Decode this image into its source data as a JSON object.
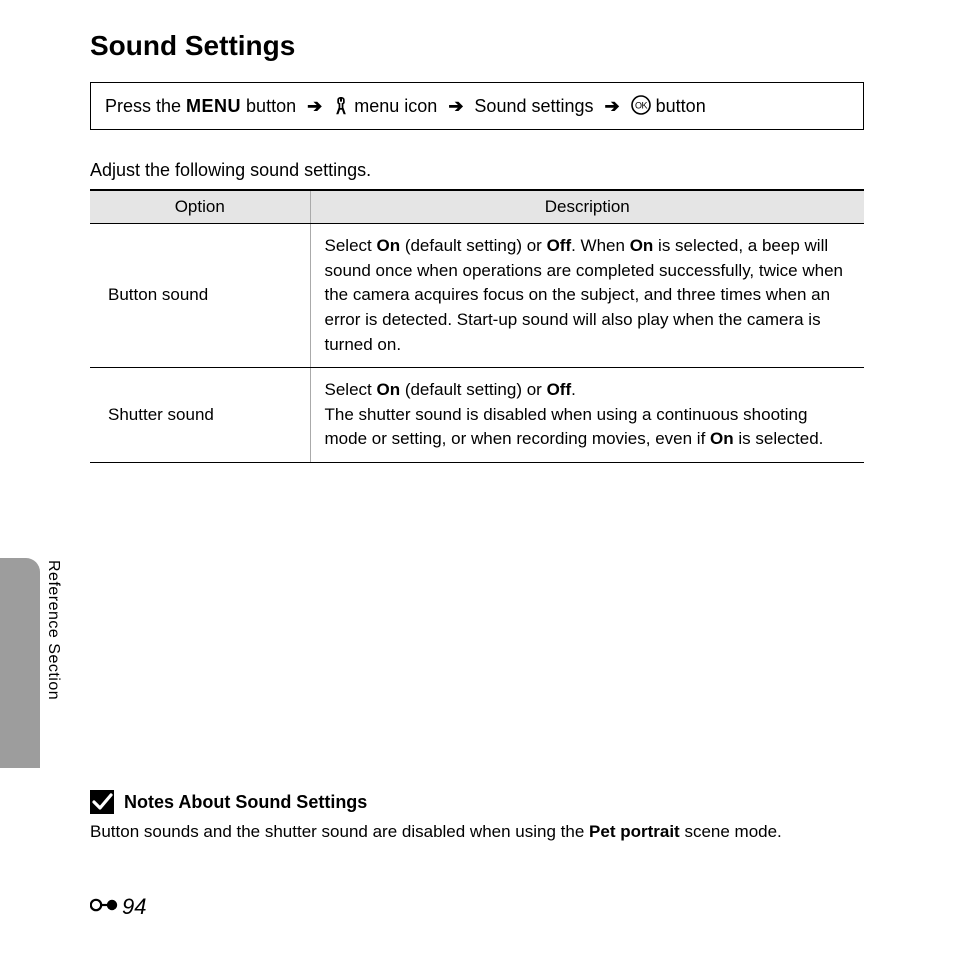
{
  "title": "Sound Settings",
  "nav": {
    "prefix": "Press the ",
    "menu_label": "MENU",
    "after_menu": " button",
    "step_icon1": "wrench",
    "after_icon1": "menu icon",
    "step_text": "Sound settings",
    "after_ok": "button",
    "arrow": "➔"
  },
  "intro": "Adjust the following sound settings.",
  "table": {
    "headers": {
      "option": "Option",
      "description": "Description"
    },
    "rows": [
      {
        "option": "Button sound",
        "desc_parts": {
          "p1": "Select ",
          "b1": "On",
          "p2": " (default setting) or ",
          "b2": "Off",
          "p3": ". When ",
          "b3": "On",
          "p4": " is selected, a beep will sound once when operations are completed successfully, twice when the camera acquires focus on the subject, and three times when an error is detected. Start-up sound will also play when the camera is turned on."
        }
      },
      {
        "option": "Shutter sound",
        "desc_parts": {
          "p1": "Select ",
          "b1": "On",
          "p2": " (default setting) or ",
          "b2": "Off",
          "p3": ".",
          "br": true,
          "p4": "The shutter sound is disabled when using a continuous shooting mode or setting, or when recording movies, even if ",
          "b3": "On",
          "p5": " is selected."
        }
      }
    ]
  },
  "side_label": "Reference Section",
  "notes": {
    "title": "Notes About Sound Settings",
    "body_p1": "Button sounds and the shutter sound are disabled when using the ",
    "body_b1": "Pet portrait",
    "body_p2": " scene mode."
  },
  "page_number": "94"
}
